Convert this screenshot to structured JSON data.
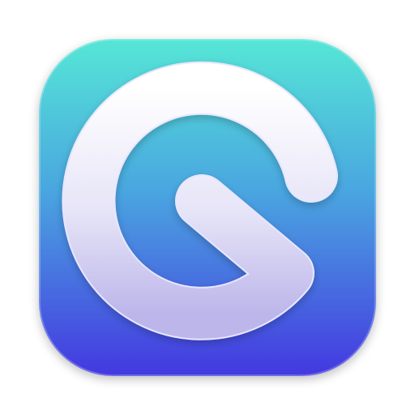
{
  "app_icon": {
    "name": "app-icon",
    "glyph": "G",
    "colors": {
      "background_top": "#55E6D6",
      "background_mid": "#4AA6E0",
      "background_bottom": "#4338E0",
      "glyph_top": "#FFFFFF",
      "glyph_bottom": "#BDB6EA",
      "glyph_outline": "#E8E6FF"
    }
  }
}
